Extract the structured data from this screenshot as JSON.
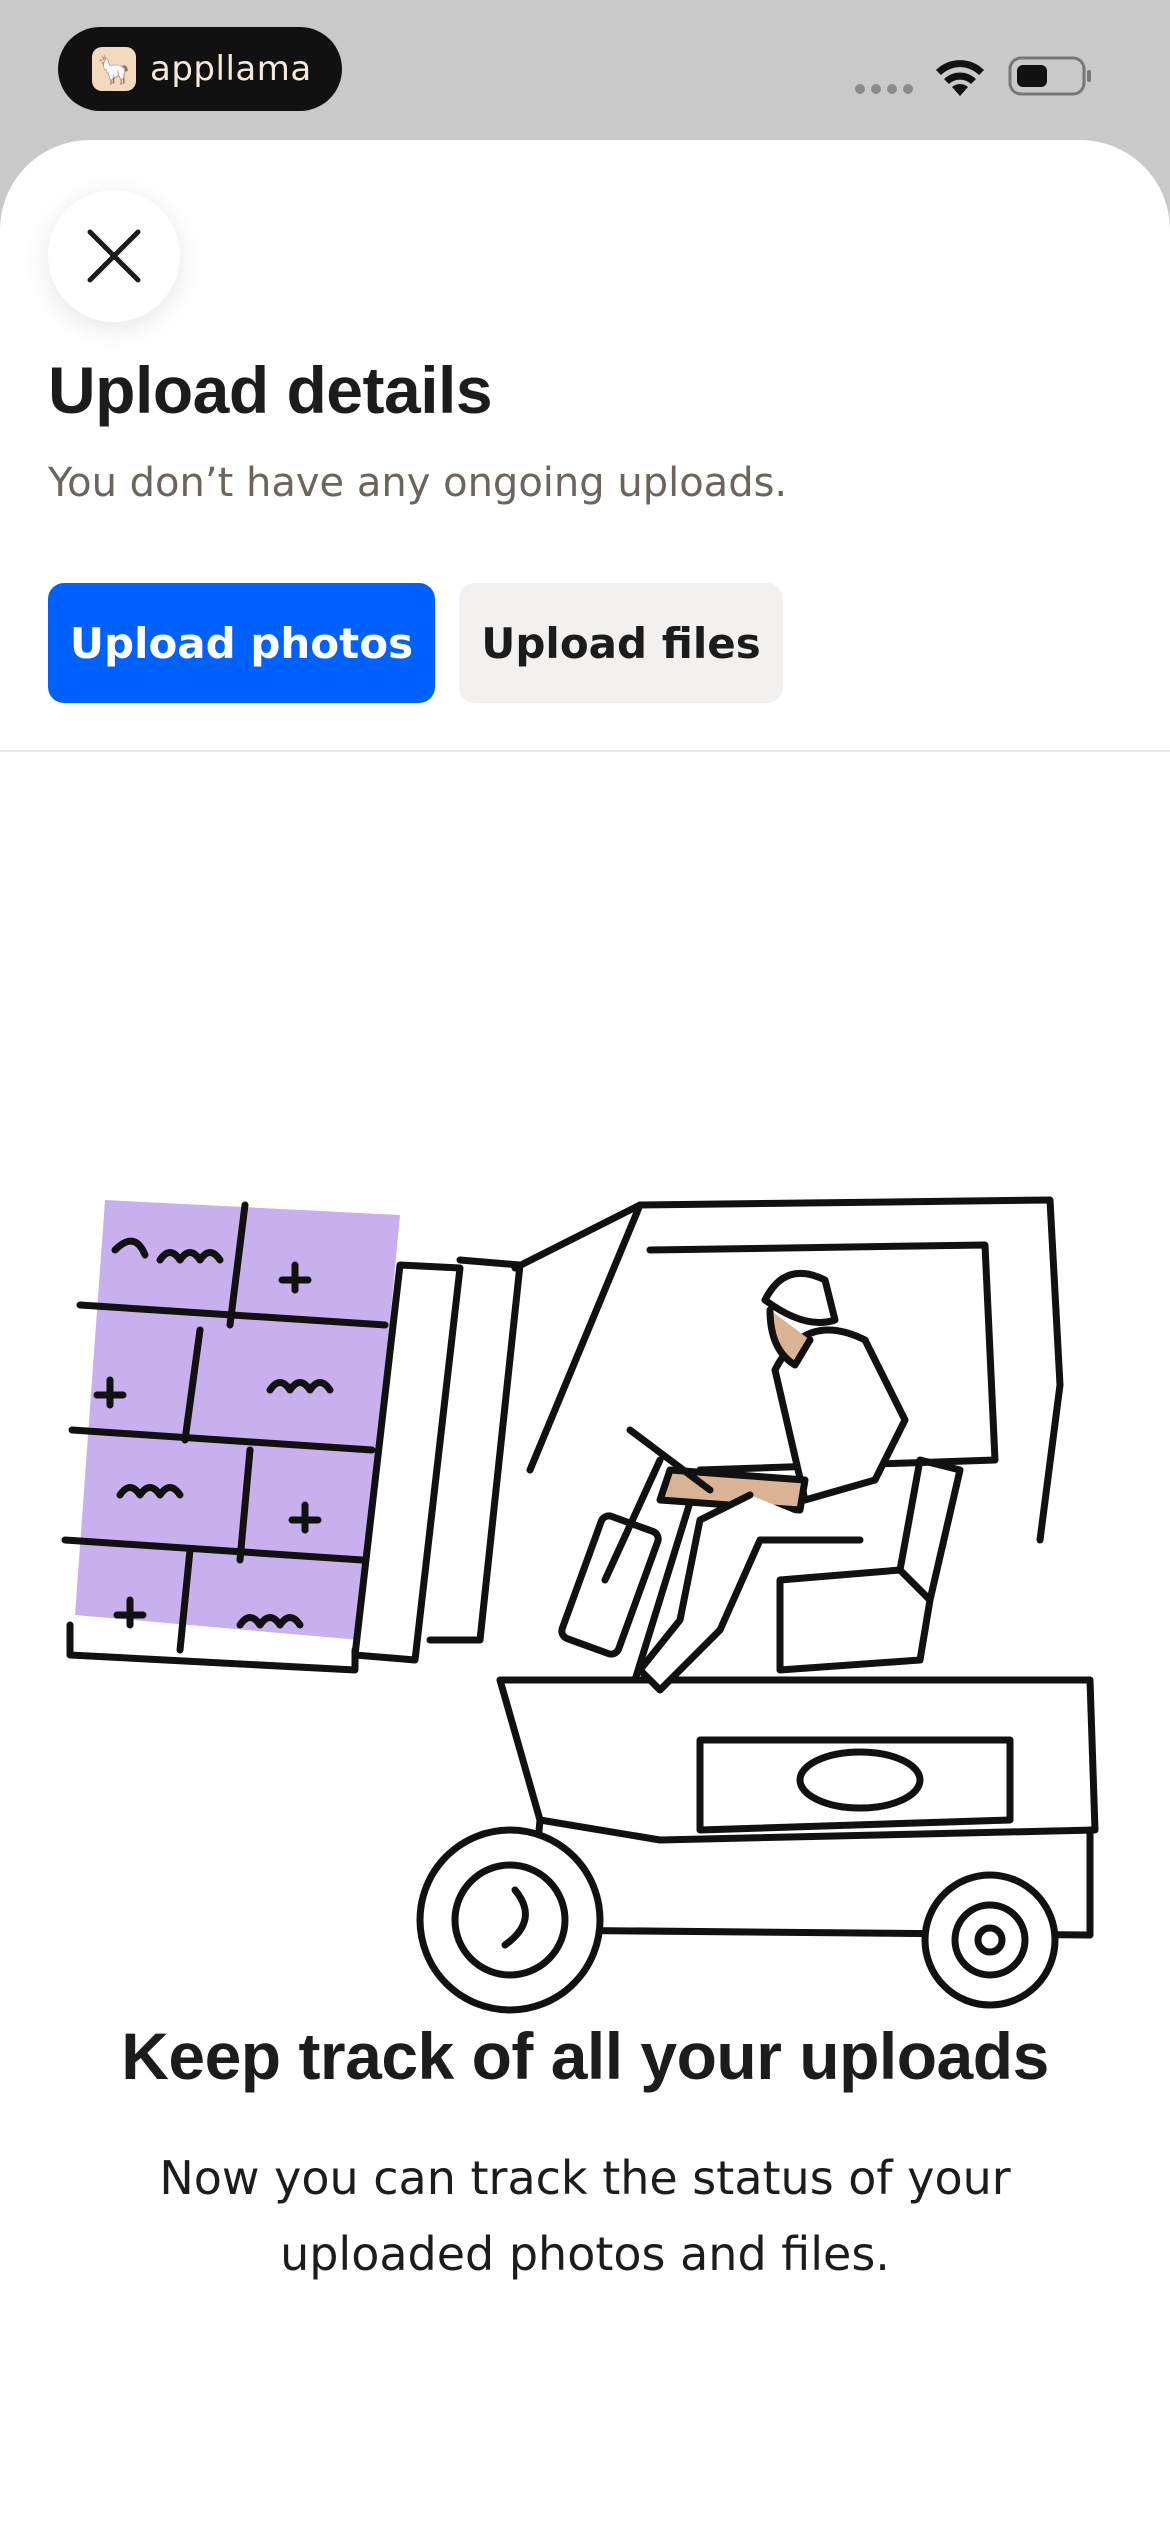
{
  "status_bar": {
    "app_name": "appllama",
    "app_logo_icon": "llama-icon",
    "signal_icon": "signal-dots-icon",
    "wifi_icon": "wifi-icon",
    "battery_icon": "battery-icon"
  },
  "sheet": {
    "close_icon": "close-icon",
    "title": "Upload details",
    "subtitle": "You don’t have any ongoing uploads.",
    "buttons": {
      "upload_photos": "Upload photos",
      "upload_files": "Upload files"
    }
  },
  "empty_state": {
    "illustration": "forklift-illustration",
    "title": "Keep track of all your uploads",
    "body": "Now you can track the status of your uploaded photos and files."
  },
  "colors": {
    "primary": "#0061fe",
    "secondary_button": "#f2f1ef",
    "boxes": "#c8b0ef",
    "skin": "#d9b394",
    "status_bar_bg": "#c9c9c9"
  }
}
